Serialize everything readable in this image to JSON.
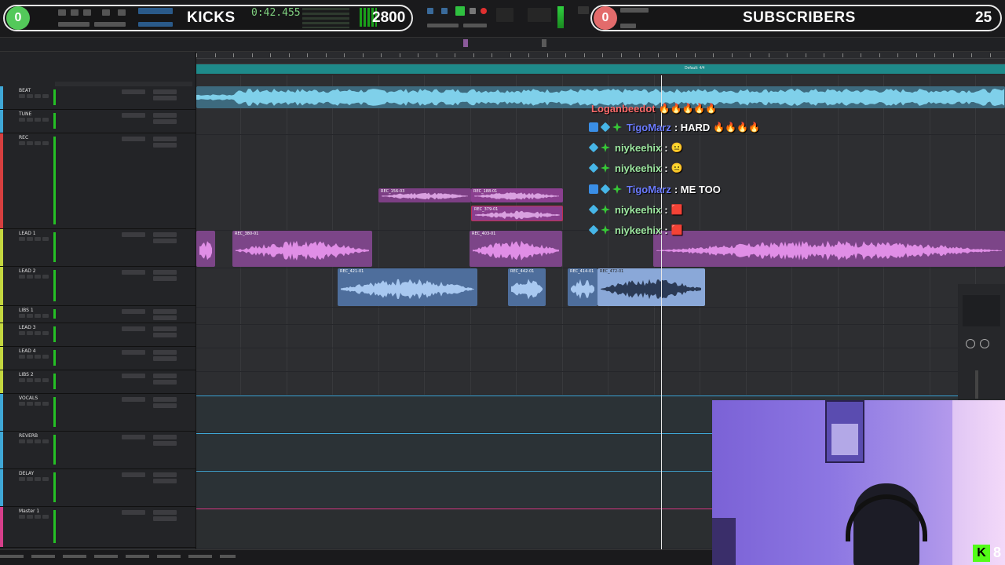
{
  "overlay": {
    "kicks_count": "0",
    "kicks_label": "KICKS",
    "time_display": "0:42.455",
    "kicks_total": "2800",
    "subs_count": "0",
    "subs_label": "SUBSCRIBERS",
    "subs_total": "25",
    "brand_corner": "8"
  },
  "colors": {
    "kicks_green": "#53c95a",
    "subs_red": "#e36b6b",
    "beat_blue": "#5fb3d3",
    "rec_purple": "#8a3f8f",
    "lead_purple": "#7c4588",
    "lead2_blue": "#5a7fb4",
    "selected_blue": "#8aa8d8"
  },
  "tracks": [
    {
      "name": "BEAT",
      "color": "#3fa7d6"
    },
    {
      "name": "TUNE",
      "color": "#3fa7d6"
    },
    {
      "name": "REC",
      "color": "#d63f3f"
    },
    {
      "name": "LEAD 1",
      "color": "#c3d63f"
    },
    {
      "name": "LEAD 2",
      "color": "#c3d63f"
    },
    {
      "name": "LIBS 1",
      "color": "#c3d63f"
    },
    {
      "name": "LEAD 3",
      "color": "#c3d63f"
    },
    {
      "name": "LEAD 4",
      "color": "#c3d63f"
    },
    {
      "name": "LIBS 2",
      "color": "#c3d63f"
    },
    {
      "name": "VOCALS",
      "color": "#3fa7d6"
    },
    {
      "name": "REVERB",
      "color": "#3fa7d6"
    },
    {
      "name": "DELAY",
      "color": "#3fa7d6"
    },
    {
      "name": "Master 1",
      "color": "#d63f8a"
    }
  ],
  "clips": {
    "rec_a": "REC_156-03",
    "rec_b": "REC_188-01",
    "rec_c": "REC_379-01",
    "lead1_a": "REC_380-01",
    "lead1_b": "REC_403-01",
    "lead2_a": "REC_421-01",
    "lead2_b": "REC_442-01",
    "lead2_c": "REC_414-01",
    "lead2_d": "REC_472-01"
  },
  "chat": [
    {
      "name": "Loganbeedot",
      "color": "#ff6b6b",
      "msg": "",
      "emote": "🔥🔥🔥🔥🔥"
    },
    {
      "name": "TigoMarz",
      "color": "#6b7bff",
      "msg": ": HARD",
      "emote": "🔥🔥🔥🔥"
    },
    {
      "name": "niykeehix",
      "color": "#9de7a0",
      "msg": ":",
      "emote": "😐"
    },
    {
      "name": "niykeehix",
      "color": "#9de7a0",
      "msg": ":",
      "emote": "😐"
    },
    {
      "name": "TigoMarz",
      "color": "#6b7bff",
      "msg": ": ME TOO",
      "emote": ""
    },
    {
      "name": "niykeehix",
      "color": "#9de7a0",
      "msg": ":",
      "emote": "🟥"
    },
    {
      "name": "niykeehix",
      "color": "#9de7a0",
      "msg": ":",
      "emote": "🟥"
    }
  ],
  "markers": {
    "default": "Default: 4/4"
  }
}
